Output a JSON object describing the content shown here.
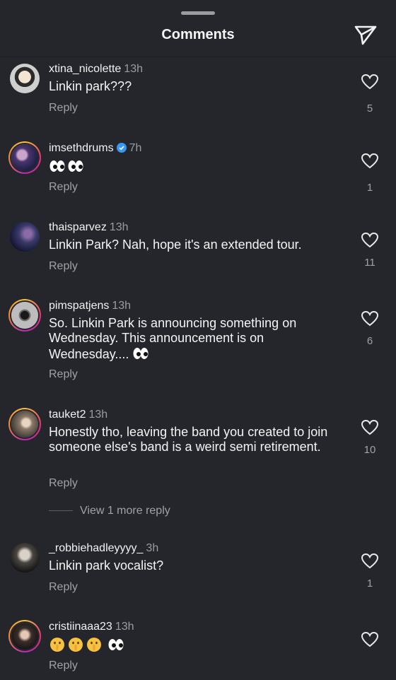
{
  "header": {
    "title": "Comments"
  },
  "comments": [
    {
      "username": "xtina_nicolette",
      "time": "13h",
      "text": "Linkin park???",
      "reply": "Reply",
      "likes": "5"
    },
    {
      "username": "imsethdrums",
      "time": "7h",
      "text": "",
      "emoji": "eyes eyes eyes eyes",
      "reply": "Reply",
      "likes": "1",
      "verified": true
    },
    {
      "username": "thaisparvez",
      "time": "13h",
      "text": "Linkin Park? Nah, hope it's an extended tour.",
      "reply": "Reply",
      "likes": "11"
    },
    {
      "username": "pimspatjens",
      "time": "13h",
      "text": "So. Linkin Park is announcing something on Wednesday. This announcement is on Wednesday....",
      "reply": "Reply",
      "likes": "6"
    },
    {
      "username": "tauket2",
      "time": "13h",
      "text": "Honestly tho, leaving the band you created to join someone else's band is a weird semi retirement.",
      "reply": "Reply",
      "likes": "10",
      "view_more": "View 1 more reply"
    },
    {
      "username": "_robbiehadleyyyy_",
      "time": "3h",
      "text": "Linkin park vocalist?",
      "reply": "Reply",
      "likes": "1"
    },
    {
      "username": "cristiinaaa23",
      "time": "13h",
      "text": "",
      "reply": "Reply",
      "likes": ""
    }
  ]
}
